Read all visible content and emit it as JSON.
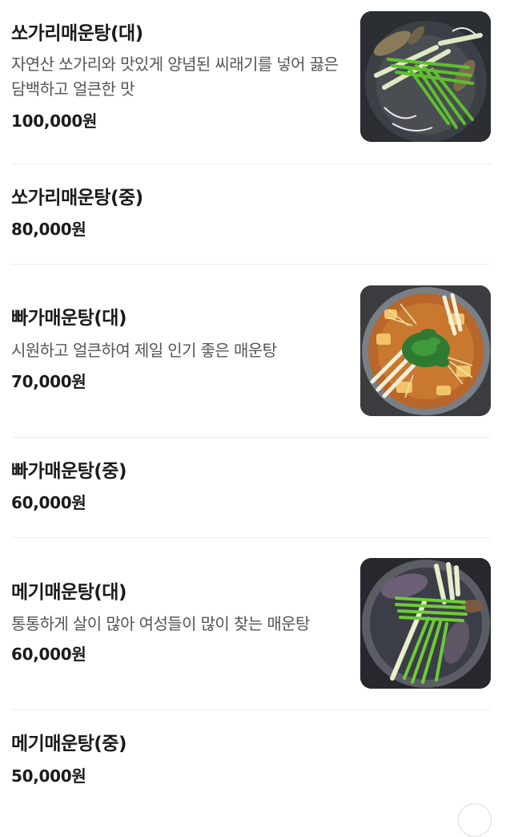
{
  "menu": {
    "items": [
      {
        "name": "쏘가리매운탕(대)",
        "description": "자연산 쏘가리와 맛있게 양념된 씨래기를 넣어 끓은 담백하고 얼큰한 맛",
        "price": "100,000원",
        "image_icon": "fish-stew-photo-icon"
      },
      {
        "name": "쏘가리매운탕(중)",
        "price": "80,000원"
      },
      {
        "name": "빠가매운탕(대)",
        "description": "시원하고 얼큰하여 제일 인기 좋은 매운탕",
        "price": "70,000원",
        "image_icon": "catfish-stew-photo-icon"
      },
      {
        "name": "빠가매운탕(중)",
        "price": "60,000원"
      },
      {
        "name": "메기매운탕(대)",
        "description": "통통하게 살이 많아 여성들이 많이 찾는 매운탕",
        "price": "60,000원",
        "image_icon": "catfish-spicy-stew-photo-icon"
      },
      {
        "name": "메기매운탕(중)",
        "price": "50,000원"
      }
    ]
  },
  "colors": {
    "text": "#1b1b1b",
    "description": "#555555",
    "divider": "#ececec",
    "background": "#ffffff"
  }
}
